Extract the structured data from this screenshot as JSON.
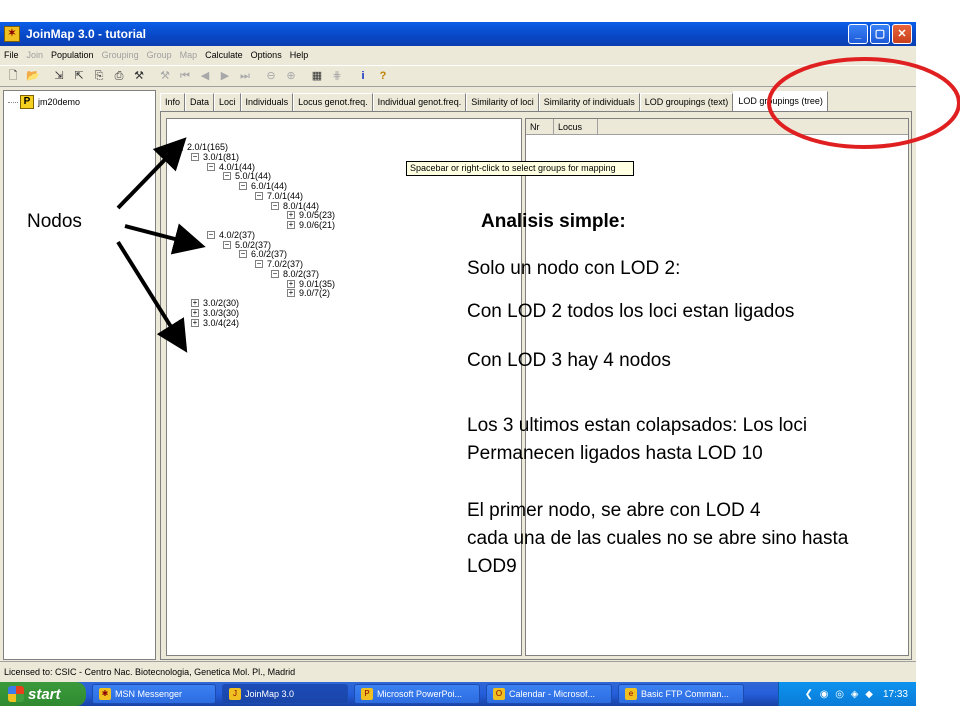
{
  "window": {
    "title": "JoinMap 3.0  -  tutorial",
    "minimize": "_",
    "maximize": "▢",
    "close": "✕"
  },
  "menu": [
    {
      "label": "File",
      "enabled": true
    },
    {
      "label": "Join",
      "enabled": false
    },
    {
      "label": "Population",
      "enabled": true
    },
    {
      "label": "Grouping",
      "enabled": false
    },
    {
      "label": "Group",
      "enabled": false
    },
    {
      "label": "Map",
      "enabled": false
    },
    {
      "label": "Calculate",
      "enabled": true
    },
    {
      "label": "Options",
      "enabled": true
    },
    {
      "label": "Help",
      "enabled": true
    }
  ],
  "left_pane": {
    "project_icon": "P",
    "project_name": "jm20demo"
  },
  "tabs": [
    "Info",
    "Data",
    "Loci",
    "Individuals",
    "Locus genot.freq.",
    "Individual genot.freq.",
    "Similarity of loci",
    "Similarity of individuals",
    "LOD groupings (text)",
    "LOD groupings (tree)"
  ],
  "active_tab": "LOD groupings (tree)",
  "tree": [
    {
      "label": "2.0/1(165)",
      "level": 0,
      "state": "−"
    },
    {
      "label": "3.0/1(81)",
      "level": 1,
      "state": "−"
    },
    {
      "label": "4.0/1(44)",
      "level": 2,
      "state": "−"
    },
    {
      "label": "5.0/1(44)",
      "level": 3,
      "state": "−"
    },
    {
      "label": "6.0/1(44)",
      "level": 4,
      "state": "−"
    },
    {
      "label": "7.0/1(44)",
      "level": 5,
      "state": "−"
    },
    {
      "label": "8.0/1(44)",
      "level": 6,
      "state": "−"
    },
    {
      "label": "9.0/5(23)",
      "level": 7,
      "state": "+"
    },
    {
      "label": "9.0/6(21)",
      "level": 7,
      "state": "+"
    },
    {
      "label": "4.0/2(37)",
      "level": 2,
      "state": "−"
    },
    {
      "label": "5.0/2(37)",
      "level": 3,
      "state": "−"
    },
    {
      "label": "6.0/2(37)",
      "level": 4,
      "state": "−"
    },
    {
      "label": "7.0/2(37)",
      "level": 5,
      "state": "−"
    },
    {
      "label": "8.0/2(37)",
      "level": 6,
      "state": "−"
    },
    {
      "label": "9.0/1(35)",
      "level": 7,
      "state": "+"
    },
    {
      "label": "9.0/7(2)",
      "level": 7,
      "state": "+"
    },
    {
      "label": "3.0/2(30)",
      "level": 1,
      "state": "+"
    },
    {
      "label": "3.0/3(30)",
      "level": 1,
      "state": "+"
    },
    {
      "label": "3.0/4(24)",
      "level": 1,
      "state": "+"
    }
  ],
  "list_columns": [
    "Nr",
    "Locus"
  ],
  "tooltip": "Spacebar or right-click to select groups for mapping",
  "status": "Licensed to: CSIC - Centro Nac. Biotecnologia, Genetica Mol. Pl., Madrid",
  "taskbar": {
    "start": "start",
    "tasks": [
      {
        "label": "MSN Messenger",
        "active": false,
        "icon": "✱"
      },
      {
        "label": "JoinMap 3.0",
        "active": true,
        "icon": "J"
      },
      {
        "label": "Microsoft PowerPoi...",
        "active": false,
        "icon": "P"
      },
      {
        "label": "Calendar - Microsof...",
        "active": false,
        "icon": "O"
      },
      {
        "label": "Basic FTP Comman...",
        "active": false,
        "icon": "e"
      }
    ],
    "tray_icons": "❮ ◉ ◎ ◈ ◆",
    "clock": "17:33"
  },
  "annotations": {
    "nodos": "Nodos",
    "heading": "Analisis simple:",
    "line1": "Solo un nodo con LOD 2:",
    "line2": "Con LOD 2 todos los loci estan ligados",
    "line3": "Con LOD 3 hay 4 nodos",
    "line4a": "Los 3 ultimos estan colapsados:  Los loci",
    "line4b": "Permanecen ligados hasta LOD 10",
    "line5a": "El primer nodo, se abre con LOD 4",
    "line5b": "cada una de las cuales no se abre sino hasta",
    "line5c": "LOD9"
  },
  "colors": {
    "highlight_ellipse": "#e02020",
    "arrow": "#000000"
  }
}
